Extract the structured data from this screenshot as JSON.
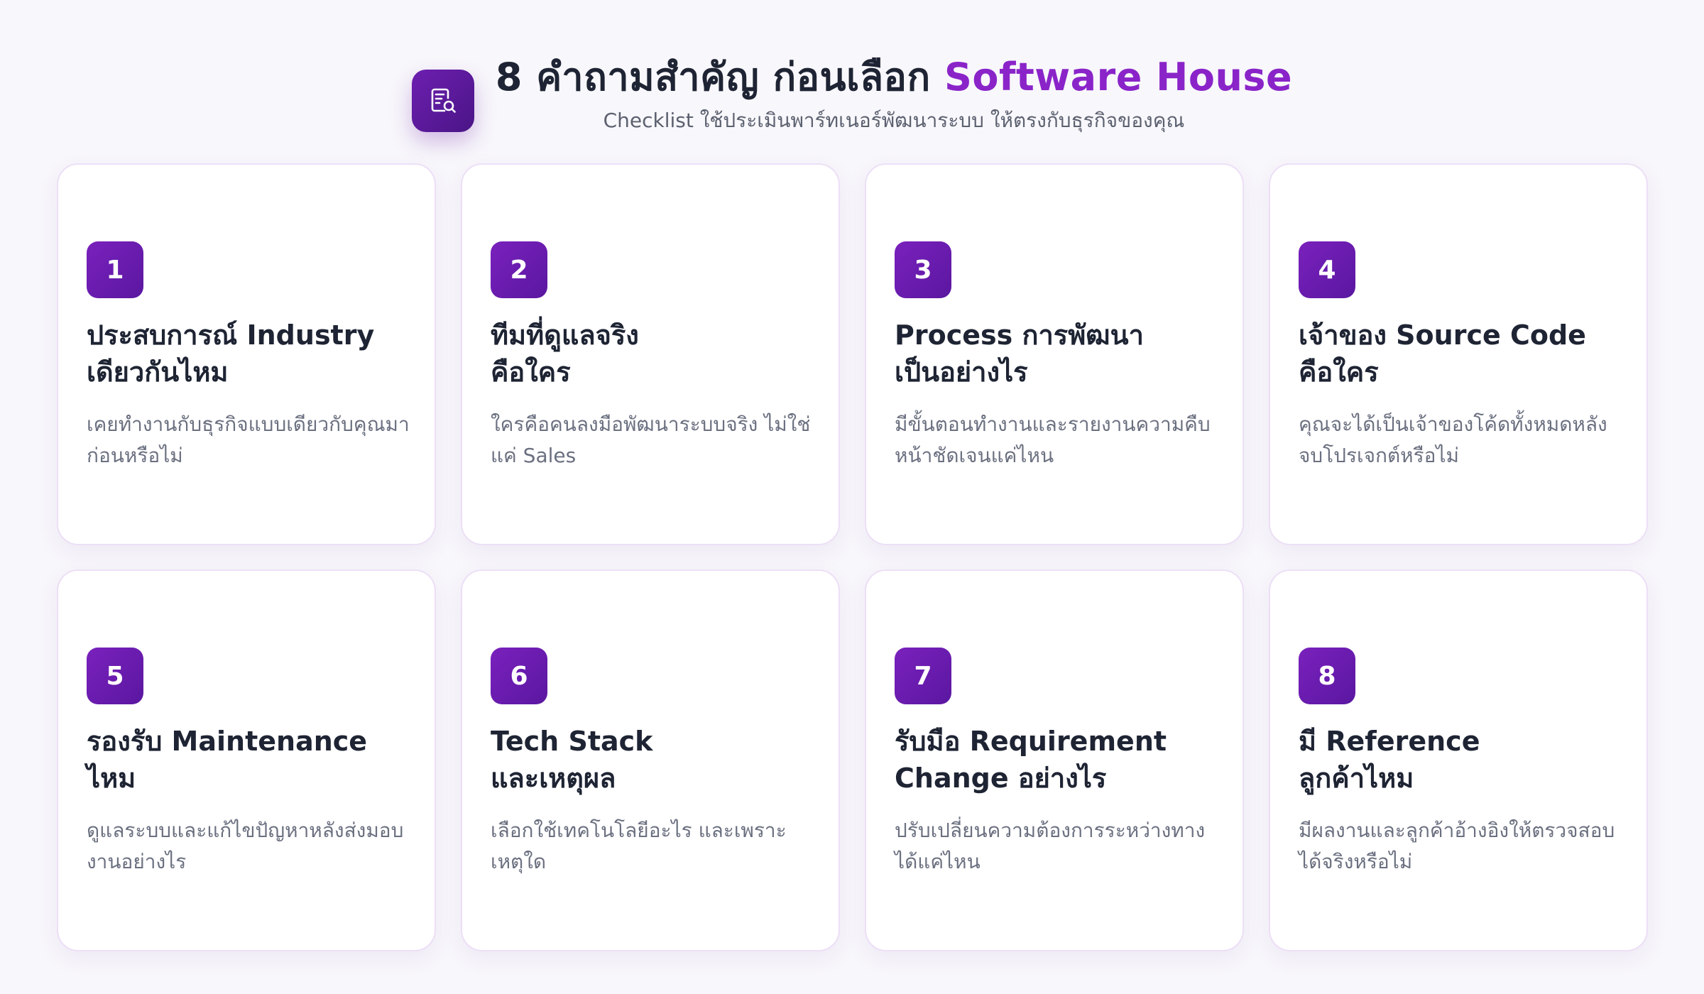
{
  "header": {
    "icon": "document-search-icon",
    "title_main": "8 คำถามสำคัญ ก่อนเลือก",
    "title_accent": "Software House",
    "subtitle": "Checklist ใช้ประเมินพาร์ทเนอร์พัฒนาระบบ ให้ตรงกับธุรกิจของคุณ"
  },
  "colors": {
    "accent": "#8a24c9",
    "badge": "#6a1bb0",
    "background": "#f8f7fb",
    "card_border": "#ecdff6"
  },
  "cards": [
    {
      "number": "1",
      "title_line1": "ประสบการณ์ Industry",
      "title_line2": "เดียวกันไหม",
      "desc_line1": "เคยทำงานกับธุรกิจแบบเดียวกับคุณมา",
      "desc_line2": "ก่อนหรือไม่"
    },
    {
      "number": "2",
      "title_line1": "ทีมที่ดูแลจริง",
      "title_line2": "คือใคร",
      "desc_line1": "ใครคือคนลงมือพัฒนาระบบจริง ไม่ใช่",
      "desc_line2": "แค่ Sales"
    },
    {
      "number": "3",
      "title_line1": "Process การพัฒนา",
      "title_line2": "เป็นอย่างไร",
      "desc_line1": "มีขั้นตอนทำงานและรายงานความคืบ",
      "desc_line2": "หน้าชัดเจนแค่ไหน"
    },
    {
      "number": "4",
      "title_line1": "เจ้าของ Source Code",
      "title_line2": "คือใคร",
      "desc_line1": "คุณจะได้เป็นเจ้าของโค้ดทั้งหมดหลัง",
      "desc_line2": "จบโปรเจกต์หรือไม่"
    },
    {
      "number": "5",
      "title_line1": "รองรับ Maintenance",
      "title_line2": "ไหม",
      "desc_line1": "ดูแลระบบและแก้ไขปัญหาหลังส่งมอบ",
      "desc_line2": "งานอย่างไร"
    },
    {
      "number": "6",
      "title_line1": "Tech Stack",
      "title_line2": "และเหตุผล",
      "desc_line1": "เลือกใช้เทคโนโลยีอะไร และเพราะ",
      "desc_line2": "เหตุใด"
    },
    {
      "number": "7",
      "title_line1": "รับมือ Requirement",
      "title_line2": "Change อย่างไร",
      "desc_line1": "ปรับเปลี่ยนความต้องการระหว่างทาง",
      "desc_line2": "ได้แค่ไหน"
    },
    {
      "number": "8",
      "title_line1": "มี Reference",
      "title_line2": "ลูกค้าไหม",
      "desc_line1": "มีผลงานและลูกค้าอ้างอิงให้ตรวจสอบ",
      "desc_line2": "ได้จริงหรือไม่"
    }
  ]
}
